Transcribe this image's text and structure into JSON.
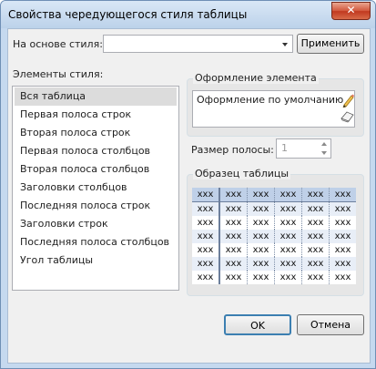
{
  "window": {
    "title": "Свойства чередующегося стиля таблицы",
    "close_glyph": "✕"
  },
  "based_on": {
    "label": "На основе стиля:",
    "value": "",
    "apply_label": "Применить"
  },
  "style_elements": {
    "label": "Элементы стиля:",
    "items": [
      {
        "label": "Вся таблица",
        "selected": true
      },
      {
        "label": "Первая полоса строк"
      },
      {
        "label": "Вторая полоса строк"
      },
      {
        "label": "Первая полоса столбцов"
      },
      {
        "label": "Вторая полоса столбцов"
      },
      {
        "label": "Заголовки столбцов"
      },
      {
        "label": "Последняя полоса строк"
      },
      {
        "label": "Заголовки строк"
      },
      {
        "label": "Последняя полоса столбцов"
      },
      {
        "label": "Угол таблицы"
      }
    ]
  },
  "formatting": {
    "label": "Оформление элемента",
    "value": "Оформление по умолчанию",
    "edit_icon": "pencil-icon",
    "clear_icon": "eraser-icon"
  },
  "stripe_size": {
    "label": "Размер полосы:",
    "value": "1"
  },
  "sample": {
    "label": "Образец таблицы",
    "rows": [
      [
        "xxx",
        "xxx",
        "xxx",
        "xxx",
        "xxx",
        "xxx"
      ],
      [
        "xxx",
        "xxx",
        "xxx",
        "xxx",
        "xxx",
        "xxx"
      ],
      [
        "xxx",
        "xxx",
        "xxx",
        "xxx",
        "xxx",
        "xxx"
      ],
      [
        "xxx",
        "xxx",
        "xxx",
        "xxx",
        "xxx",
        "xxx"
      ],
      [
        "xxx",
        "xxx",
        "xxx",
        "xxx",
        "xxx",
        "xxx"
      ],
      [
        "xxx",
        "xxx",
        "xxx",
        "xxx",
        "xxx",
        "xxx"
      ],
      [
        "xxx",
        "xxx",
        "xxx",
        "xxx",
        "xxx",
        "xxx"
      ]
    ]
  },
  "buttons": {
    "ok": "OK",
    "cancel": "Отмена"
  },
  "colors": {
    "title_bar": "#c5d9ef",
    "close_button": "#c8452b",
    "header_row": "#bfd0e8",
    "stripe_row": "#e8eef7"
  }
}
